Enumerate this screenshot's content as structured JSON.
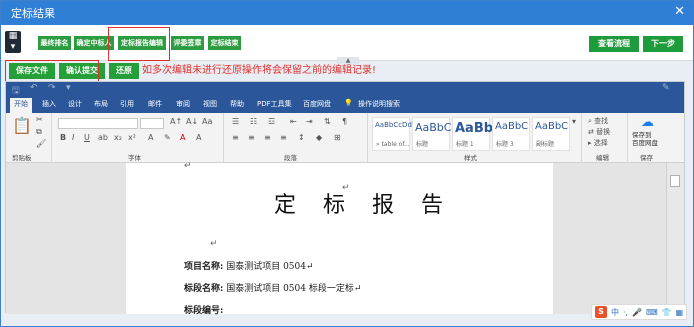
{
  "window": {
    "title": "定标结果",
    "close": "✕"
  },
  "steps": [
    {
      "label": "最终排名"
    },
    {
      "label": "确定中标人"
    },
    {
      "label": "定标报告编辑"
    },
    {
      "label": "评委签章"
    },
    {
      "label": "定标结束"
    }
  ],
  "right_buttons": {
    "view_flow": "查看流程",
    "next": "下一步"
  },
  "actions": {
    "save": "保存文件",
    "confirm": "确认提交",
    "restore": "还原"
  },
  "warning": "如多次编辑未进行还原操作将会保留之前的编辑记录!",
  "word": {
    "tabs": [
      "开始",
      "插入",
      "设计",
      "布局",
      "引用",
      "邮件",
      "审阅",
      "视图",
      "帮助",
      "PDF工具集",
      "百度网盘",
      "操作说明搜索"
    ],
    "groups": {
      "clipboard": "剪贴板",
      "font": "字体",
      "paragraph": "段落",
      "styles": "样式",
      "editing": "编辑",
      "save": "保存"
    },
    "styles": [
      {
        "big": "AaBbCcDd",
        "small": "» table of..."
      },
      {
        "big": "AaBbC",
        "small": "标题"
      },
      {
        "big": "AaBb",
        "small": "标题 1"
      },
      {
        "big": "AaBbC",
        "small": "标题 3"
      },
      {
        "big": "AaBbC",
        "small": "副标题"
      }
    ],
    "editing": {
      "find": "查找",
      "replace": "替换",
      "select": "选择"
    },
    "save_to_baidu": "保存到\n百度网盘"
  },
  "document": {
    "title": "定 标 报 告",
    "return_mark": "↵",
    "fields": [
      {
        "label": "项目名称:",
        "value": "国泰测试项目 0504↵"
      },
      {
        "label": "标段名称:",
        "value": "国泰测试项目 0504 标段一定标↵"
      },
      {
        "label": "标段编号:",
        "value": ""
      }
    ]
  },
  "tray": {
    "ime": "中",
    "items": [
      "中",
      "·,",
      "🎤",
      "⌨",
      "👕",
      "▦"
    ]
  }
}
